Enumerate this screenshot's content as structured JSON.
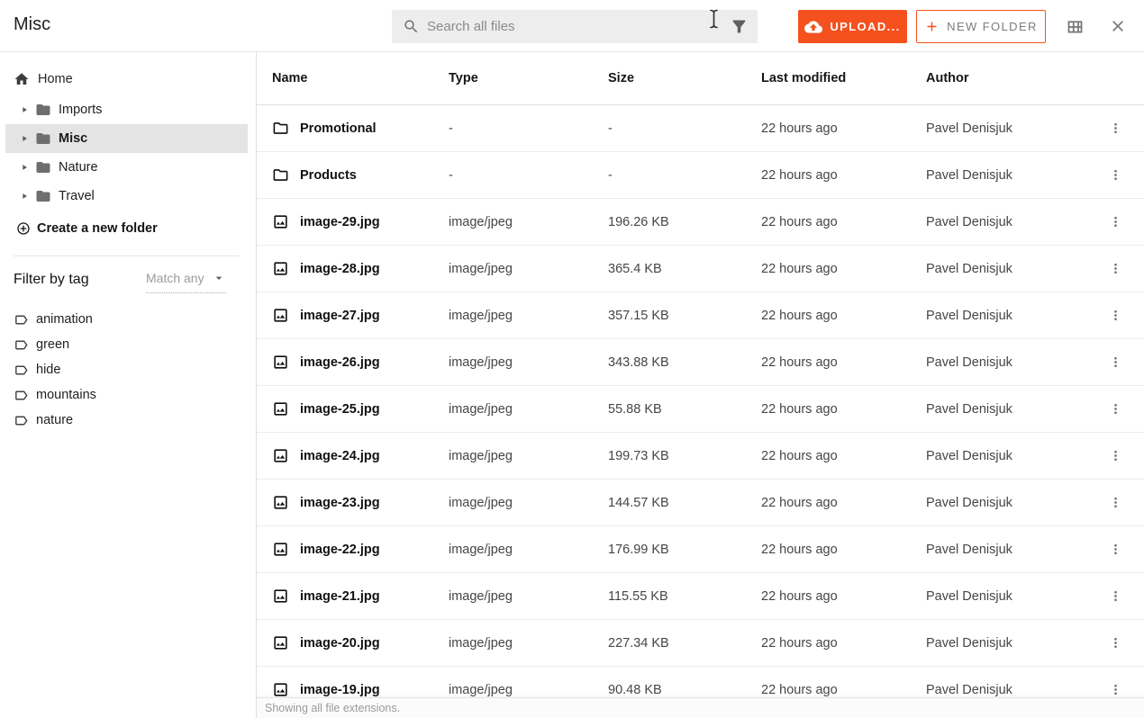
{
  "header": {
    "title": "Misc",
    "search_placeholder": "Search all files",
    "search_value": "",
    "upload_label": "UPLOAD...",
    "new_folder_label": "NEW FOLDER"
  },
  "sidebar": {
    "home_label": "Home",
    "folders": [
      {
        "label": "Imports",
        "selected": false
      },
      {
        "label": "Misc",
        "selected": true
      },
      {
        "label": "Nature",
        "selected": false
      },
      {
        "label": "Travel",
        "selected": false
      }
    ],
    "create_folder_label": "Create a new folder",
    "filter_heading": "Filter by tag",
    "match_dropdown_value": "Match any",
    "tags": [
      "animation",
      "green",
      "hide",
      "mountains",
      "nature"
    ]
  },
  "table": {
    "columns": [
      "Name",
      "Type",
      "Size",
      "Last modified",
      "Author"
    ],
    "rows": [
      {
        "name": "Promotional",
        "kind": "folder",
        "type": "-",
        "size": "-",
        "modified": "22 hours ago",
        "author": "Pavel Denisjuk"
      },
      {
        "name": "Products",
        "kind": "folder",
        "type": "-",
        "size": "-",
        "modified": "22 hours ago",
        "author": "Pavel Denisjuk"
      },
      {
        "name": "image-29.jpg",
        "kind": "image",
        "type": "image/jpeg",
        "size": "196.26 KB",
        "modified": "22 hours ago",
        "author": "Pavel Denisjuk"
      },
      {
        "name": "image-28.jpg",
        "kind": "image",
        "type": "image/jpeg",
        "size": "365.4 KB",
        "modified": "22 hours ago",
        "author": "Pavel Denisjuk"
      },
      {
        "name": "image-27.jpg",
        "kind": "image",
        "type": "image/jpeg",
        "size": "357.15 KB",
        "modified": "22 hours ago",
        "author": "Pavel Denisjuk"
      },
      {
        "name": "image-26.jpg",
        "kind": "image",
        "type": "image/jpeg",
        "size": "343.88 KB",
        "modified": "22 hours ago",
        "author": "Pavel Denisjuk"
      },
      {
        "name": "image-25.jpg",
        "kind": "image",
        "type": "image/jpeg",
        "size": "55.88 KB",
        "modified": "22 hours ago",
        "author": "Pavel Denisjuk"
      },
      {
        "name": "image-24.jpg",
        "kind": "image",
        "type": "image/jpeg",
        "size": "199.73 KB",
        "modified": "22 hours ago",
        "author": "Pavel Denisjuk"
      },
      {
        "name": "image-23.jpg",
        "kind": "image",
        "type": "image/jpeg",
        "size": "144.57 KB",
        "modified": "22 hours ago",
        "author": "Pavel Denisjuk"
      },
      {
        "name": "image-22.jpg",
        "kind": "image",
        "type": "image/jpeg",
        "size": "176.99 KB",
        "modified": "22 hours ago",
        "author": "Pavel Denisjuk"
      },
      {
        "name": "image-21.jpg",
        "kind": "image",
        "type": "image/jpeg",
        "size": "115.55 KB",
        "modified": "22 hours ago",
        "author": "Pavel Denisjuk"
      },
      {
        "name": "image-20.jpg",
        "kind": "image",
        "type": "image/jpeg",
        "size": "227.34 KB",
        "modified": "22 hours ago",
        "author": "Pavel Denisjuk"
      },
      {
        "name": "image-19.jpg",
        "kind": "image",
        "type": "image/jpeg",
        "size": "90.48 KB",
        "modified": "22 hours ago",
        "author": "Pavel Denisjuk"
      }
    ]
  },
  "footer": {
    "status": "Showing all file extensions."
  },
  "icons": {
    "search": "magnifier-icon",
    "filter": "funnel-icon",
    "upload": "cloud-upload-icon",
    "new_folder": "plus-icon",
    "view_toggle": "grid-icon",
    "close": "x-icon",
    "home": "house-icon",
    "tree_caret": "triangle-right-icon",
    "tree_folder": "folder-filled-icon",
    "create_folder": "circle-plus-icon",
    "tag": "label-outline-icon",
    "row_folder": "folder-outline-icon",
    "row_image": "image-icon",
    "row_menu": "kebab-vertical-icon",
    "pointer": "i-beam-cursor"
  },
  "colors": {
    "accent": "#F4511E",
    "selected_item_bg": "#e4e4e4",
    "search_bg": "#ededed",
    "muted_text": "#9b9b9b"
  }
}
